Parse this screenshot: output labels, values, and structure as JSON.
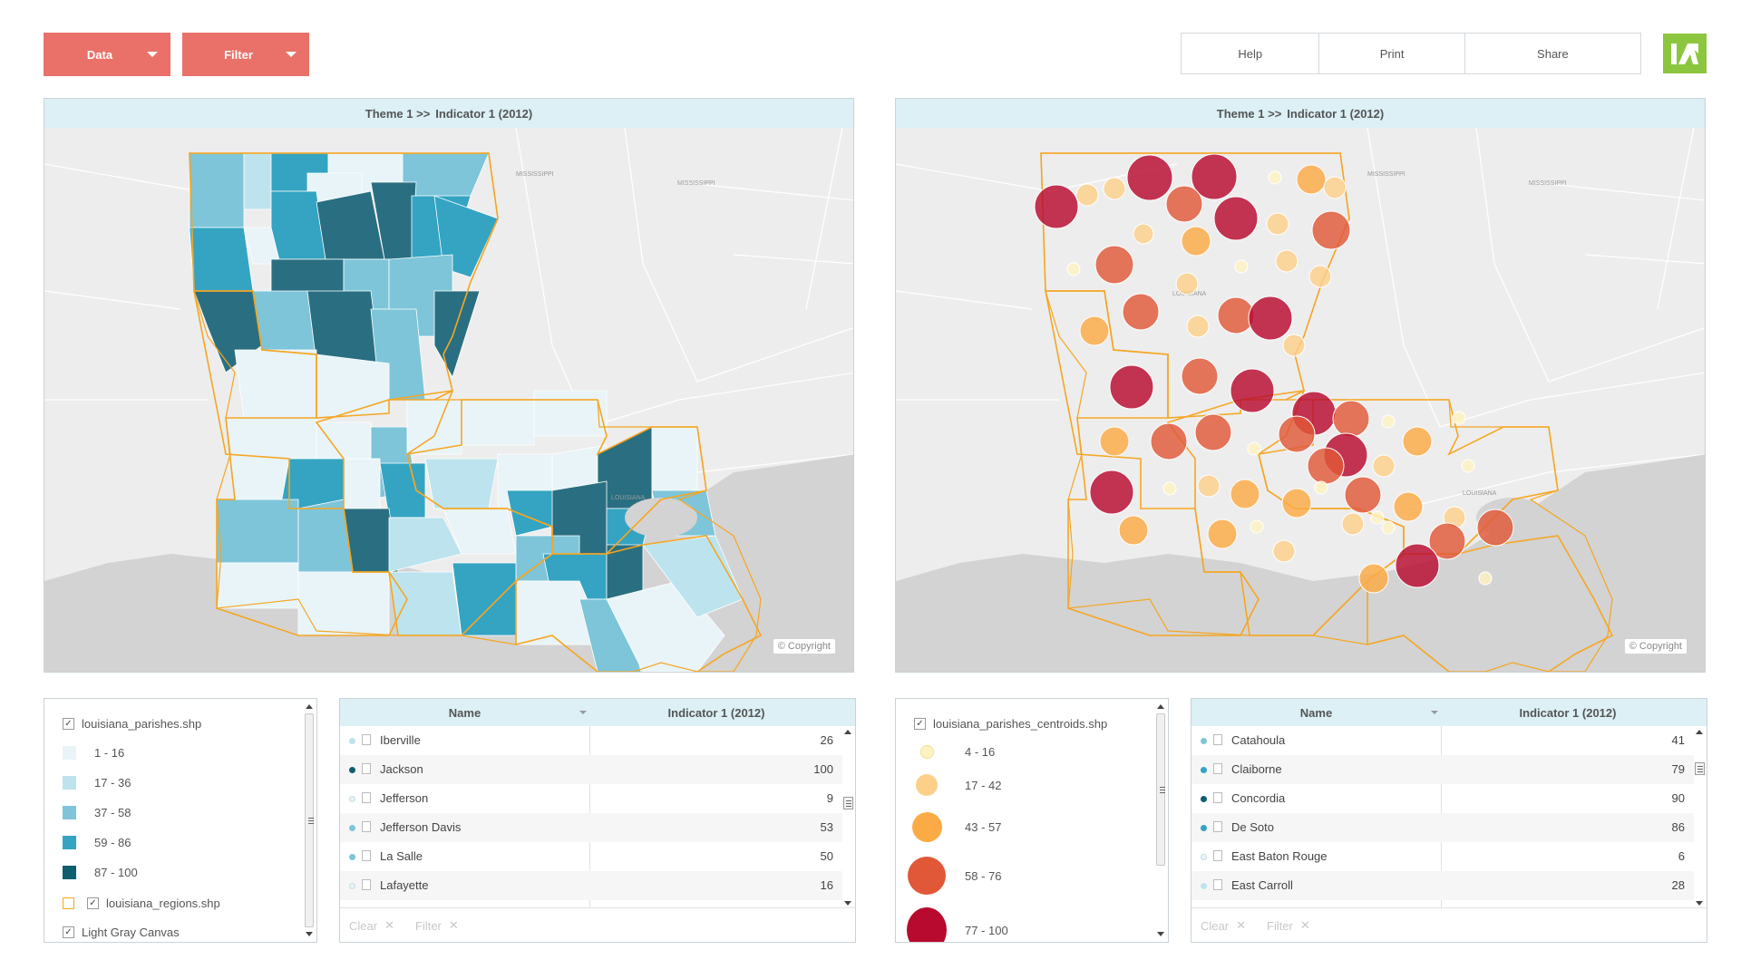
{
  "toolbar": {
    "data_label": "Data",
    "filter_label": "Filter",
    "help_label": "Help",
    "print_label": "Print",
    "share_label": "Share",
    "colors": {
      "accent_button": "#e9716a",
      "logo": "#8cc63f"
    }
  },
  "left_map": {
    "header": {
      "theme": "Theme 1 >>",
      "indicator": "Indicator 1 (2012)"
    },
    "place_labels": [
      "MISSISSIPPI",
      "MISSISSIPPI",
      "LOUISIANA"
    ],
    "copyright": "© Copyright"
  },
  "right_map": {
    "header": {
      "theme": "Theme 1 >>",
      "indicator": "Indicator 1 (2012)"
    },
    "place_labels": [
      "MISSISSIPPI",
      "MISSISSIPPI",
      "LOUISIANA",
      "LOUISIANA"
    ],
    "copyright": "© Copyright"
  },
  "left_legend": {
    "layer_name": "louisiana_parishes.shp",
    "classes": [
      {
        "label": "1 - 16",
        "color": "#e8f4f8"
      },
      {
        "label": "17 - 36",
        "color": "#bde4ee"
      },
      {
        "label": "37 - 58",
        "color": "#7ec5d9"
      },
      {
        "label": "59 - 86",
        "color": "#34a4c2"
      },
      {
        "label": "87 - 100",
        "color": "#0f5e70"
      }
    ],
    "regions_layer": "louisiana_regions.shp",
    "regions_color": "#f5a623",
    "basemap_layer": "Light Gray Canvas"
  },
  "left_table": {
    "col_name": "Name",
    "col_value": "Indicator 1 (2012)",
    "rows": [
      {
        "name": "Iberville",
        "value": "26",
        "color": "#bde4ee"
      },
      {
        "name": "Jackson",
        "value": "100",
        "color": "#0f5e70"
      },
      {
        "name": "Jefferson",
        "value": "9",
        "color": "#e8f4f8"
      },
      {
        "name": "Jefferson Davis",
        "value": "53",
        "color": "#7ec5d9"
      },
      {
        "name": "La Salle",
        "value": "50",
        "color": "#7ec5d9"
      },
      {
        "name": "Lafayette",
        "value": "16",
        "color": "#e8f4f8"
      }
    ],
    "footer": {
      "clear": "Clear",
      "filter": "Filter"
    }
  },
  "right_legend": {
    "layer_name": "louisiana_parishes_centroids.shp",
    "classes": [
      {
        "label": "4 - 16",
        "color": "#fff3c2"
      },
      {
        "label": "17 - 42",
        "color": "#fdd08a"
      },
      {
        "label": "43 - 57",
        "color": "#fbab45"
      },
      {
        "label": "58 - 76",
        "color": "#e05838"
      },
      {
        "label": "77 - 100",
        "color": "#b80a2e"
      }
    ]
  },
  "right_table": {
    "col_name": "Name",
    "col_value": "Indicator 1 (2012)",
    "rows": [
      {
        "name": "Catahoula",
        "value": "41",
        "color": "#7ec5d9"
      },
      {
        "name": "Claiborne",
        "value": "79",
        "color": "#34a4c2"
      },
      {
        "name": "Concordia",
        "value": "90",
        "color": "#0f5e70"
      },
      {
        "name": "De Soto",
        "value": "86",
        "color": "#34a4c2"
      },
      {
        "name": "East Baton Rouge",
        "value": "6",
        "color": "#e8f4f8"
      },
      {
        "name": "East Carroll",
        "value": "28",
        "color": "#bde4ee"
      }
    ],
    "footer": {
      "clear": "Clear",
      "filter": "Filter"
    }
  }
}
